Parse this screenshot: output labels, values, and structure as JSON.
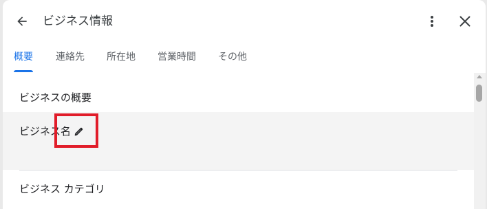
{
  "dialog": {
    "title": "ビジネス情報",
    "back_icon": "arrow-back-icon",
    "more_icon": "more-vert-icon",
    "close_icon": "close-icon"
  },
  "tabs": [
    {
      "label": "概要",
      "active": true
    },
    {
      "label": "連絡先",
      "active": false
    },
    {
      "label": "所在地",
      "active": false
    },
    {
      "label": "営業時間",
      "active": false
    },
    {
      "label": "その他",
      "active": false
    }
  ],
  "section": {
    "heading": "ビジネスの概要",
    "fields": [
      {
        "label": "ビジネス名",
        "edit_icon": "pencil-icon"
      },
      {
        "label": "ビジネス カテゴリ"
      }
    ]
  },
  "colors": {
    "accent": "#1a73e8",
    "highlight": "#e11d2a"
  }
}
